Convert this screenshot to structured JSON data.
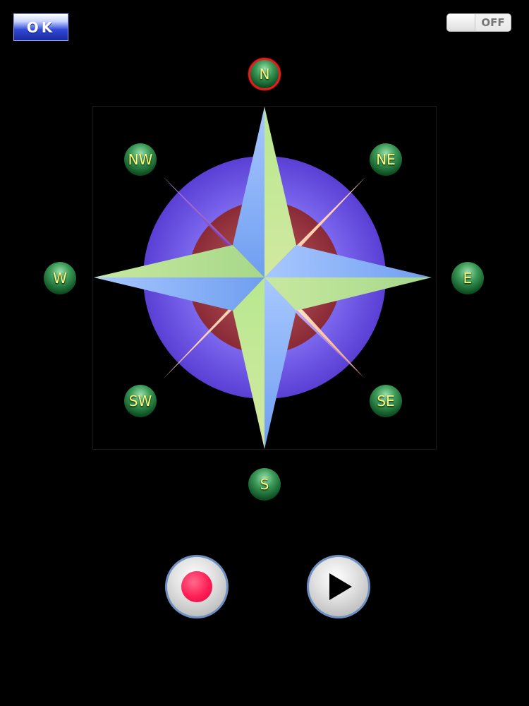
{
  "toolbar": {
    "ok_label": "OK",
    "toggle_label": "OFF"
  },
  "compass": {
    "selected": "N",
    "directions": {
      "n": "N",
      "ne": "NE",
      "e": "E",
      "se": "SE",
      "s": "S",
      "sw": "SW",
      "w": "W",
      "nw": "NW"
    }
  },
  "controls": {
    "record_icon": "record-icon",
    "play_icon": "play-icon"
  },
  "colors": {
    "background": "#000000",
    "ball_text": "#f6ff7a",
    "selected_ring": "#e02020",
    "record": "#ff1e55",
    "button_border": "#6d8fc2"
  }
}
